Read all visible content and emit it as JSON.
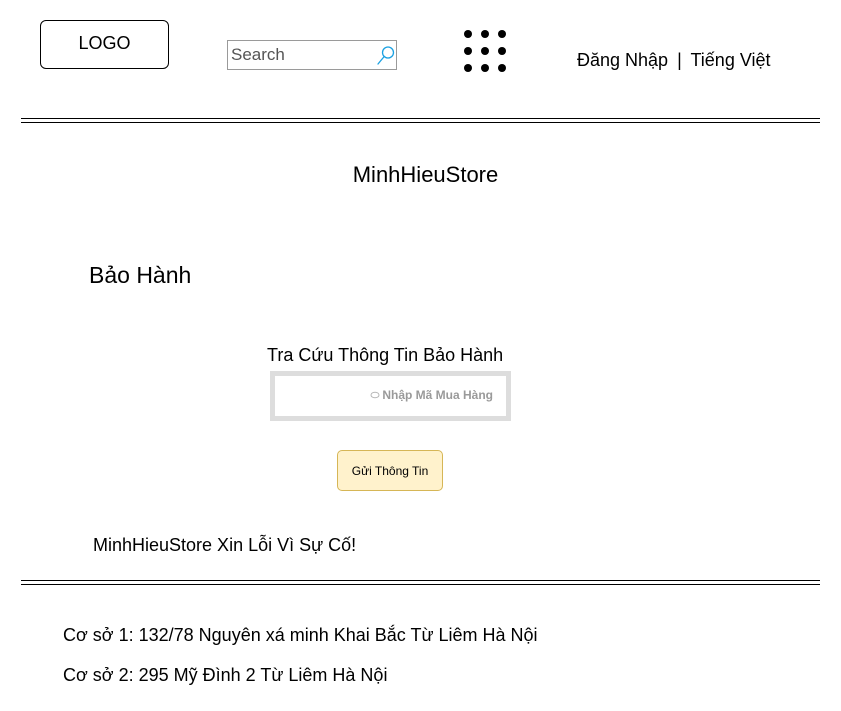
{
  "header": {
    "logo_label": "LOGO",
    "search": {
      "placeholder": "Search",
      "value": ""
    },
    "icons": {
      "search": "search-icon",
      "apps": "apps-grid-icon"
    },
    "login_label": "Đăng Nhập",
    "separator": "|",
    "language_label": "Tiếng Việt"
  },
  "main": {
    "store_name": "MinhHieuStore",
    "page_heading": "Bảo Hành",
    "lookup": {
      "label": "Tra Cứu Thông Tin Bảo Hành",
      "placeholder": "Nhập Mã Mua Hàng",
      "value": ""
    },
    "submit_label": "Gửi Thông Tin",
    "apology": "MinhHieuStore Xin Lỗi Vì Sự Cố!"
  },
  "footer": {
    "addresses": [
      "Cơ sở 1: 132/78 Nguyên xá minh Khai Bắc Từ Liêm Hà Nội",
      "Cơ sở 2: 295 Mỹ Đình 2 Từ Liêm Hà Nội"
    ]
  },
  "colors": {
    "search_icon": "#1ba1e2",
    "button_fill": "#fff2cc",
    "button_border": "#d6b656",
    "field_border": "#dddddd",
    "placeholder_text": "#9a9a9a"
  }
}
